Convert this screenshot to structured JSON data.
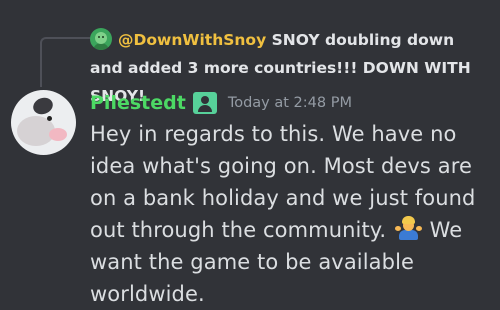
{
  "reply": {
    "author": "@DownWithSnoy",
    "text": "SNOY doubling down and added 3 more countries!!! DOWN WITH SNOY!",
    "avatar_icon": "frog-avatar-icon"
  },
  "message": {
    "author": "Pilestedt",
    "role_icon": "person-badge-icon",
    "timestamp": "Today at 2:48 PM",
    "text_before_emoji": "Hey in regards to this. We have no idea what's going on. Most devs are on a bank holiday and we just found out through the community.",
    "emoji": "person-shrugging-icon",
    "text_after_emoji": "We want the game to be available worldwide."
  },
  "colors": {
    "background": "#313338",
    "author": "#4cd964",
    "reply_author": "#f0c040",
    "text": "#dbdee1",
    "timestamp": "#949ba4"
  }
}
